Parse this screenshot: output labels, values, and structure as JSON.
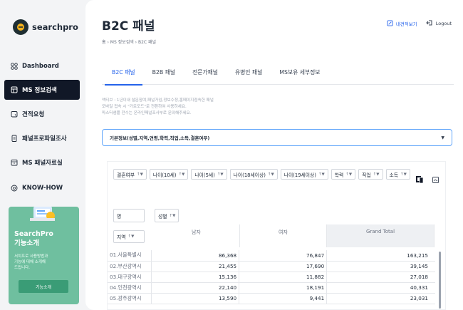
{
  "brand": {
    "name": "searchpro"
  },
  "nav": [
    {
      "label": "Dashboard",
      "icon": "dashboard-icon"
    },
    {
      "label": "MS 정보검색",
      "icon": "search-box-icon"
    },
    {
      "label": "견적요청",
      "icon": "estimate-icon"
    },
    {
      "label": "패널프로파일조사",
      "icon": "profile-icon"
    },
    {
      "label": "MS 패널자료실",
      "icon": "archive-icon"
    },
    {
      "label": "KNOW-HOW",
      "icon": "info-icon"
    }
  ],
  "promo": {
    "title": "SearchPro\n기능소개",
    "desc": "서치프로 사용방법과\n기능에 대해 소개해\n드립니다.",
    "button": "기능소개"
  },
  "page": {
    "title": "B2C 패널",
    "breadcrumb": [
      "홈",
      "MS 정보검색",
      "B2C 패널"
    ]
  },
  "actions": {
    "history": "내견적보기",
    "logout": "Logout"
  },
  "tabs": [
    "B2C 패널",
    "B2B 패널",
    "전문가패널",
    "유병인 패널",
    "MS보유 세부정보"
  ],
  "notes": [
    "액티브 : 1년이내 설문참여,패널가입,정보수정,홈페이지접속한 패널",
    "모바일 접속 시 \"가로모드\"로 전환하여 사용하세요.",
    "마스터샘플 전수는 온라인패널조사부로 문의해주세요."
  ],
  "select": {
    "value": "기본정보(성별,지역,연령,학력,직업,소득,결혼여부)"
  },
  "chips": [
    "결혼여부",
    "나이(10세)",
    "나이(5세)",
    "나이(18세이상)",
    "나이(19세이상)",
    "학력",
    "직업",
    "소득"
  ],
  "pivot": {
    "value_field": "명",
    "column_field": "성별",
    "row_field": "지역",
    "columns": [
      "남자",
      "여자",
      "Grand Total"
    ],
    "rows": [
      {
        "label": "01.서울특별시",
        "values": [
          "86,368",
          "76,847",
          "163,215"
        ]
      },
      {
        "label": "02.부산광역시",
        "values": [
          "21,455",
          "17,690",
          "39,145"
        ]
      },
      {
        "label": "03.대구광역시",
        "values": [
          "15,136",
          "11,882",
          "27,018"
        ]
      },
      {
        "label": "04.인천광역시",
        "values": [
          "22,140",
          "18,191",
          "40,331"
        ]
      },
      {
        "label": "05.광주광역시",
        "values": [
          "13,590",
          "9,441",
          "23,031"
        ]
      }
    ]
  }
}
